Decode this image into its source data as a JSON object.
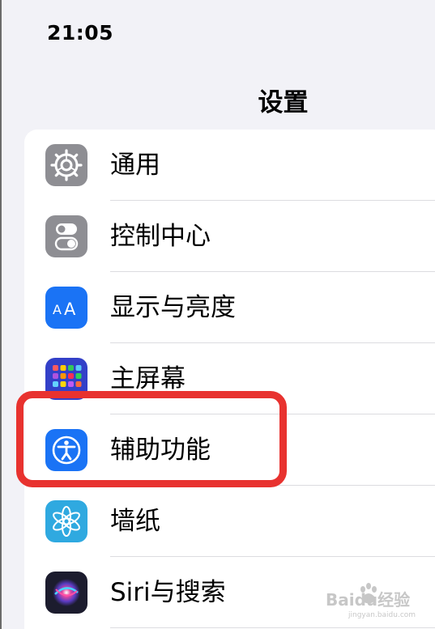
{
  "status_bar": {
    "time": "21:05"
  },
  "nav": {
    "title": "设置"
  },
  "settings_items": [
    {
      "label": "通用",
      "icon": "gear-icon",
      "color": "#8e8e93"
    },
    {
      "label": "控制中心",
      "icon": "toggle-switches-icon",
      "color": "#8e8e93"
    },
    {
      "label": "显示与亮度",
      "icon": "text-size-icon",
      "color": "#1a73f5"
    },
    {
      "label": "主屏幕",
      "icon": "home-screen-grid-icon",
      "color": "#3340c8"
    },
    {
      "label": "辅助功能",
      "icon": "accessibility-icon",
      "color": "#1a73f5"
    },
    {
      "label": "墙纸",
      "icon": "flower-icon",
      "color": "#2fa9e0"
    },
    {
      "label": "Siri与搜索",
      "icon": "siri-icon",
      "color": "#1c1c2e"
    }
  ],
  "highlight": {
    "color": "#e8322f"
  },
  "watermark": {
    "brand": "Baidu经验",
    "domain": "jingyan.baidu.com"
  }
}
